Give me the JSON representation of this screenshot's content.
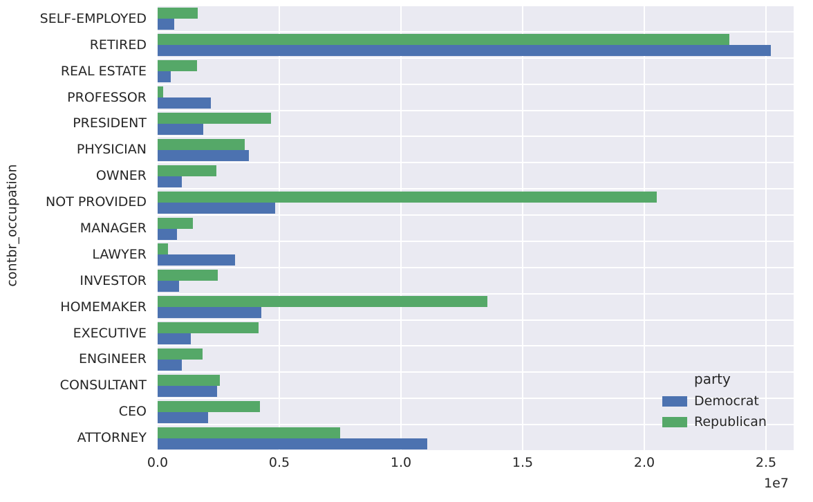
{
  "chart_data": {
    "type": "bar",
    "orientation": "horizontal",
    "title": "",
    "xlabel": "",
    "ylabel": "contbr_occupation",
    "x_tick_labels": [
      "0.0",
      "0.5",
      "1.0",
      "1.5",
      "2.0",
      "2.5"
    ],
    "x_tick_values": [
      0,
      5000000,
      10000000,
      15000000,
      20000000,
      25000000
    ],
    "x_offset_text": "1e7",
    "xlim": [
      0,
      26136000
    ],
    "grid": true,
    "legend": {
      "title": "party",
      "position": "lower right",
      "entries": [
        {
          "name": "Democrat",
          "color": "#4c72b0"
        },
        {
          "name": "Republican",
          "color": "#55a868"
        }
      ]
    },
    "categories": [
      "SELF-EMPLOYED",
      "RETIRED",
      "REAL ESTATE",
      "PROFESSOR",
      "PRESIDENT",
      "PHYSICIAN",
      "OWNER",
      "NOT PROVIDED",
      "MANAGER",
      "LAWYER",
      "INVESTOR",
      "HOMEMAKER",
      "EXECUTIVE",
      "ENGINEER",
      "CONSULTANT",
      "CEO",
      "ATTORNEY"
    ],
    "series": [
      {
        "name": "Democrat",
        "color": "#4c72b0",
        "values": [
          680000,
          25200000,
          540000,
          2190000,
          1880000,
          3750000,
          990000,
          4830000,
          800000,
          3180000,
          880000,
          4270000,
          1360000,
          990000,
          2440000,
          2070000,
          11080000
        ]
      },
      {
        "name": "Republican",
        "color": "#55a868",
        "values": [
          1650000,
          23500000,
          1620000,
          230000,
          4660000,
          3580000,
          2410000,
          20500000,
          1450000,
          430000,
          2470000,
          13550000,
          4150000,
          1850000,
          2560000,
          4200000,
          7500000
        ]
      }
    ],
    "style": {
      "plot_background": "#eaeaf2",
      "figure_background": "#ffffff",
      "grid_color": "#ffffff",
      "text_color": "#262626"
    }
  }
}
